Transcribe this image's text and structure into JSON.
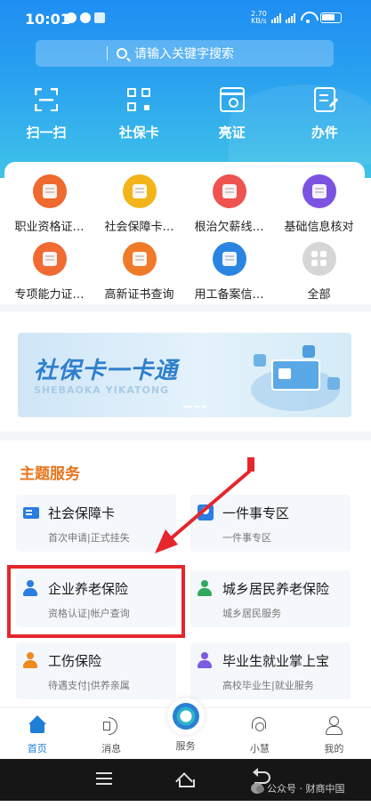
{
  "status_bar": {
    "time": "10:01",
    "speed_value": "2.70",
    "speed_unit": "KB/s"
  },
  "search": {
    "placeholder": "请输入关键字搜索"
  },
  "top_nav": [
    {
      "label": "扫一扫",
      "icon": "scan-icon"
    },
    {
      "label": "社保卡",
      "icon": "qr-code-icon"
    },
    {
      "label": "亮证",
      "icon": "id-card-icon"
    },
    {
      "label": "办件",
      "icon": "document-edit-icon"
    }
  ],
  "services_grid": [
    {
      "label": "职业资格证…",
      "color": "#ee6a2e",
      "icon": "certificate-icon"
    },
    {
      "label": "社会保障卡…",
      "color": "#f2b418",
      "icon": "social-security-card-icon"
    },
    {
      "label": "根治欠薪线…",
      "color": "#ee5350",
      "icon": "wage-clue-icon"
    },
    {
      "label": "基础信息核对",
      "color": "#7c53e0",
      "icon": "info-check-icon"
    },
    {
      "label": "专项能力证…",
      "color": "#f06a33",
      "icon": "ability-certificate-icon"
    },
    {
      "label": "高新证书查询",
      "color": "#ef7a2a",
      "icon": "high-tech-certificate-icon"
    },
    {
      "label": "用工备案信…",
      "color": "#2a85e2",
      "icon": "employment-record-icon"
    },
    {
      "label": "全部",
      "color": "#d6d6d6",
      "icon": "all-grid-icon"
    }
  ],
  "banner": {
    "title": "社保卡一卡通",
    "subtitle": "SHEBAOKA YIKATONG"
  },
  "section": {
    "title": "主题服务"
  },
  "tiles": [
    {
      "title": "社会保障卡",
      "sub": "首次申请|正式挂失",
      "icon": "card-icon"
    },
    {
      "title": "一件事专区",
      "sub": "一件事专区",
      "icon": "person-badge-icon"
    },
    {
      "title": "企业养老保险",
      "sub": "资格认证|帐户查询",
      "icon": "elder-person-icon"
    },
    {
      "title": "城乡居民养老保险",
      "sub": "城乡居民服务",
      "icon": "resident-person-icon"
    },
    {
      "title": "工伤保险",
      "sub": "待遇支付|供养亲属",
      "icon": "injury-person-icon"
    },
    {
      "title": "毕业生就业掌上宝",
      "sub": "高校毕业生|就业服务",
      "icon": "graduate-icon"
    }
  ],
  "tabbar": [
    {
      "label": "首页",
      "icon": "home-icon"
    },
    {
      "label": "消息",
      "icon": "speaker-icon"
    },
    {
      "label": "服务",
      "icon": "service-logo-icon"
    },
    {
      "label": "小慧",
      "icon": "headset-icon"
    },
    {
      "label": "我的",
      "icon": "user-icon"
    }
  ],
  "watermark": {
    "text": "公众号 · 财商中国"
  },
  "colors": {
    "accent_blue": "#1e7ed8",
    "section_orange": "#e8741c",
    "annotation_red": "#e5262d"
  }
}
